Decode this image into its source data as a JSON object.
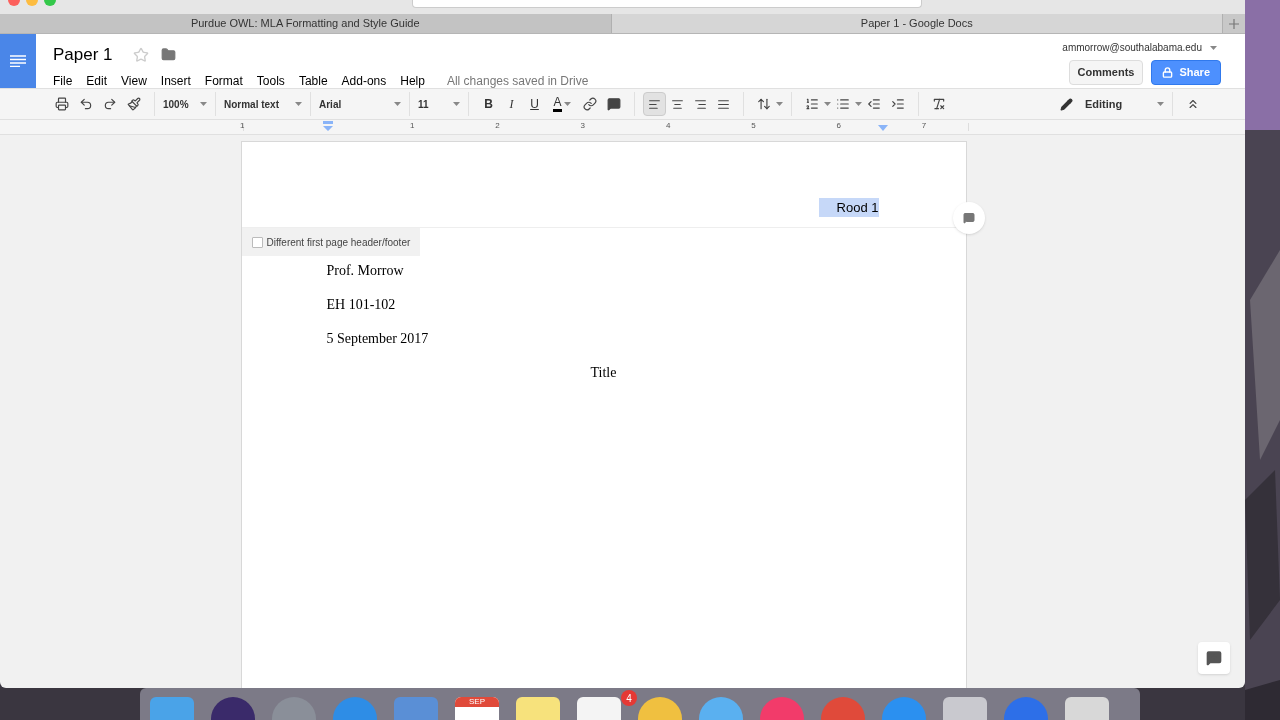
{
  "browser_tabs": [
    {
      "title": "Purdue OWL: MLA Formatting and Style Guide",
      "selected": false
    },
    {
      "title": "Paper 1 - Google Docs",
      "selected": true
    }
  ],
  "doc": {
    "title": "Paper 1",
    "starred": false
  },
  "menu": [
    "File",
    "Edit",
    "View",
    "Insert",
    "Format",
    "Tools",
    "Table",
    "Add-ons",
    "Help"
  ],
  "save_status": "All changes saved in Drive",
  "account": "ammorrow@southalabama.edu",
  "comments_button": "Comments",
  "share_button": "Share",
  "toolbar": {
    "zoom": "100%",
    "style": "Normal text",
    "font": "Arial",
    "size": "11",
    "mode": "Editing"
  },
  "format_buttons": [
    {
      "kind": "bold",
      "label": "B"
    },
    {
      "kind": "italic",
      "label": "I"
    },
    {
      "kind": "underline",
      "label": "U"
    },
    {
      "kind": "color",
      "label": "A"
    }
  ],
  "alignments": [
    {
      "kind": "left",
      "selected": true
    },
    {
      "kind": "center",
      "selected": false
    },
    {
      "kind": "right",
      "selected": false
    },
    {
      "kind": "justify",
      "selected": false
    }
  ],
  "ruler_labels": [
    "1",
    "1",
    "2",
    "3",
    "4",
    "5",
    "6",
    "7"
  ],
  "header": {
    "text": "Rood 1",
    "selected": true,
    "different_first_page": {
      "label": "Different first page header/footer",
      "checked": false
    }
  },
  "body": [
    {
      "text": "Prof. Morrow",
      "kind": "line"
    },
    {
      "text": "EH 101-102",
      "kind": "line"
    },
    {
      "text": "5 September 2017",
      "kind": "line"
    },
    {
      "text": "Title",
      "kind": "title"
    }
  ],
  "dock": [
    {
      "kind": "finder"
    },
    {
      "kind": "siri"
    },
    {
      "kind": "launchpad"
    },
    {
      "kind": "safari"
    },
    {
      "kind": "mail"
    },
    {
      "kind": "calendar",
      "month": "SEP"
    },
    {
      "kind": "notes"
    },
    {
      "kind": "reminders",
      "badge": "4"
    },
    {
      "kind": "photos"
    },
    {
      "kind": "messages"
    },
    {
      "kind": "music"
    },
    {
      "kind": "chrome"
    },
    {
      "kind": "appstore"
    },
    {
      "kind": "settings"
    },
    {
      "kind": "blue"
    },
    {
      "kind": "trash"
    }
  ]
}
